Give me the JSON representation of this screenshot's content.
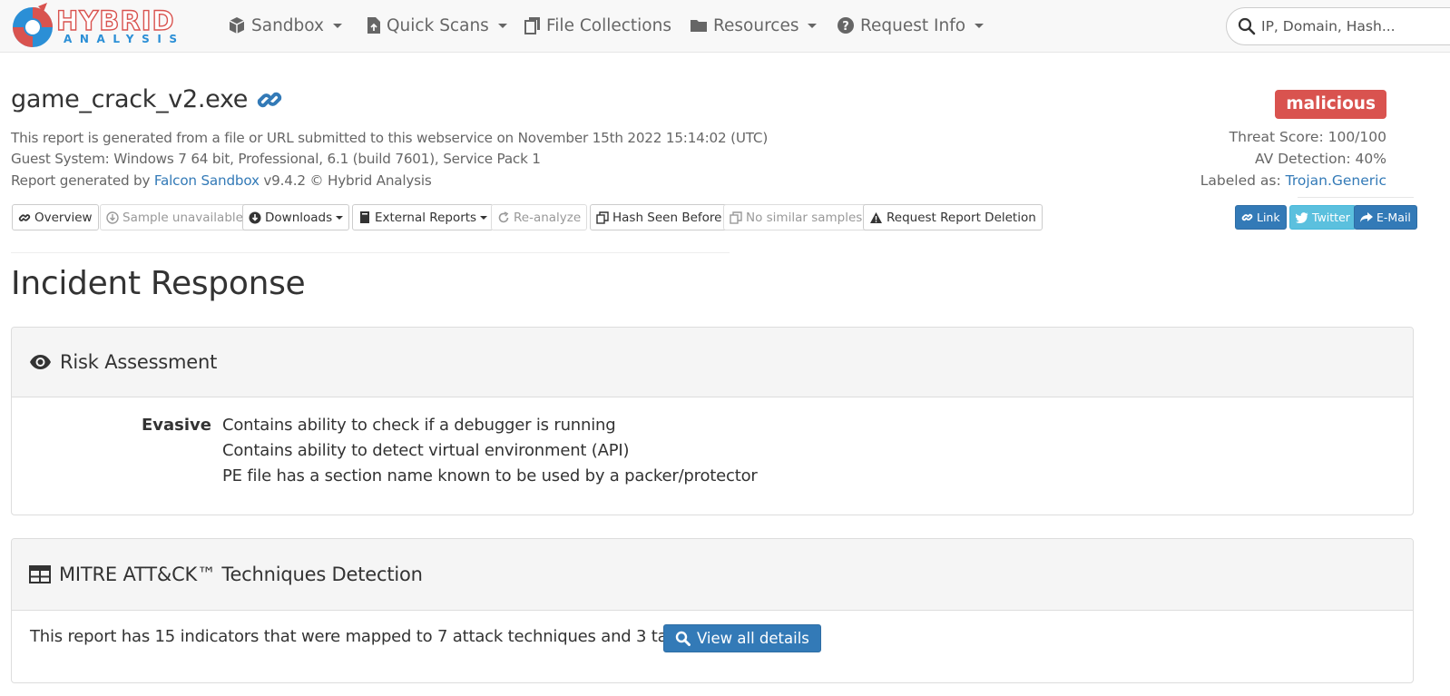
{
  "nav": {
    "logo_main": "HYBRID",
    "logo_sub": "ANALYSIS",
    "items": [
      {
        "label": "Sandbox",
        "icon": "cube-icon",
        "dropdown": true
      },
      {
        "label": "Quick Scans",
        "icon": "file-upload-icon",
        "dropdown": true
      },
      {
        "label": "File Collections",
        "icon": "files-icon",
        "dropdown": false
      },
      {
        "label": "Resources",
        "icon": "folder-icon",
        "dropdown": true
      },
      {
        "label": "Request Info",
        "icon": "question-circle-icon",
        "dropdown": true
      }
    ],
    "search_placeholder": "IP, Domain, Hash..."
  },
  "report": {
    "file_name": "game_crack_v2.exe",
    "submitted_text": "This report is generated from a file or URL submitted to this webservice on November 15th 2022 15:14:02 (UTC)",
    "guest_system": "Guest System: Windows 7 64 bit, Professional, 6.1 (build 7601), Service Pack 1",
    "generated_by_prefix": "Report generated by ",
    "generated_by_link": "Falcon Sandbox",
    "generated_by_suffix": " v9.4.2 © Hybrid Analysis",
    "verdict": "malicious",
    "threat_score": "Threat Score: 100/100",
    "av_detection": "AV Detection: 40%",
    "labeled_as_prefix": "Labeled as: ",
    "labeled_as_link": "Trojan.Generic"
  },
  "toolbar": {
    "overview": "Overview",
    "sample_unavailable": "Sample unavailable",
    "downloads": "Downloads",
    "external_reports": "External Reports",
    "reanalyze": "Re-analyze",
    "hash_seen_before": "Hash Seen Before",
    "no_similar_samples": "No similar samples",
    "request_deletion": "Request Report Deletion",
    "share_link": "Link",
    "share_twitter": "Twitter",
    "share_email": "E-Mail"
  },
  "section_title": "Incident Response",
  "risk_assessment": {
    "title": "Risk Assessment",
    "category": "Evasive",
    "items": [
      "Contains ability to check if a debugger is running",
      "Contains ability to detect virtual environment (API)",
      "PE file has a section name known to be used by a packer/protector"
    ]
  },
  "mitre": {
    "title": "MITRE ATT&CK™ Techniques Detection",
    "summary": "This report has 15 indicators that were mapped to 7 attack techniques and 3 tactics.",
    "button": "View all details"
  },
  "colors": {
    "brand_red": "#d9534f",
    "brand_blue": "#2b8fd6",
    "link_blue": "#337ab7",
    "twitter_blue": "#5bc0de"
  }
}
